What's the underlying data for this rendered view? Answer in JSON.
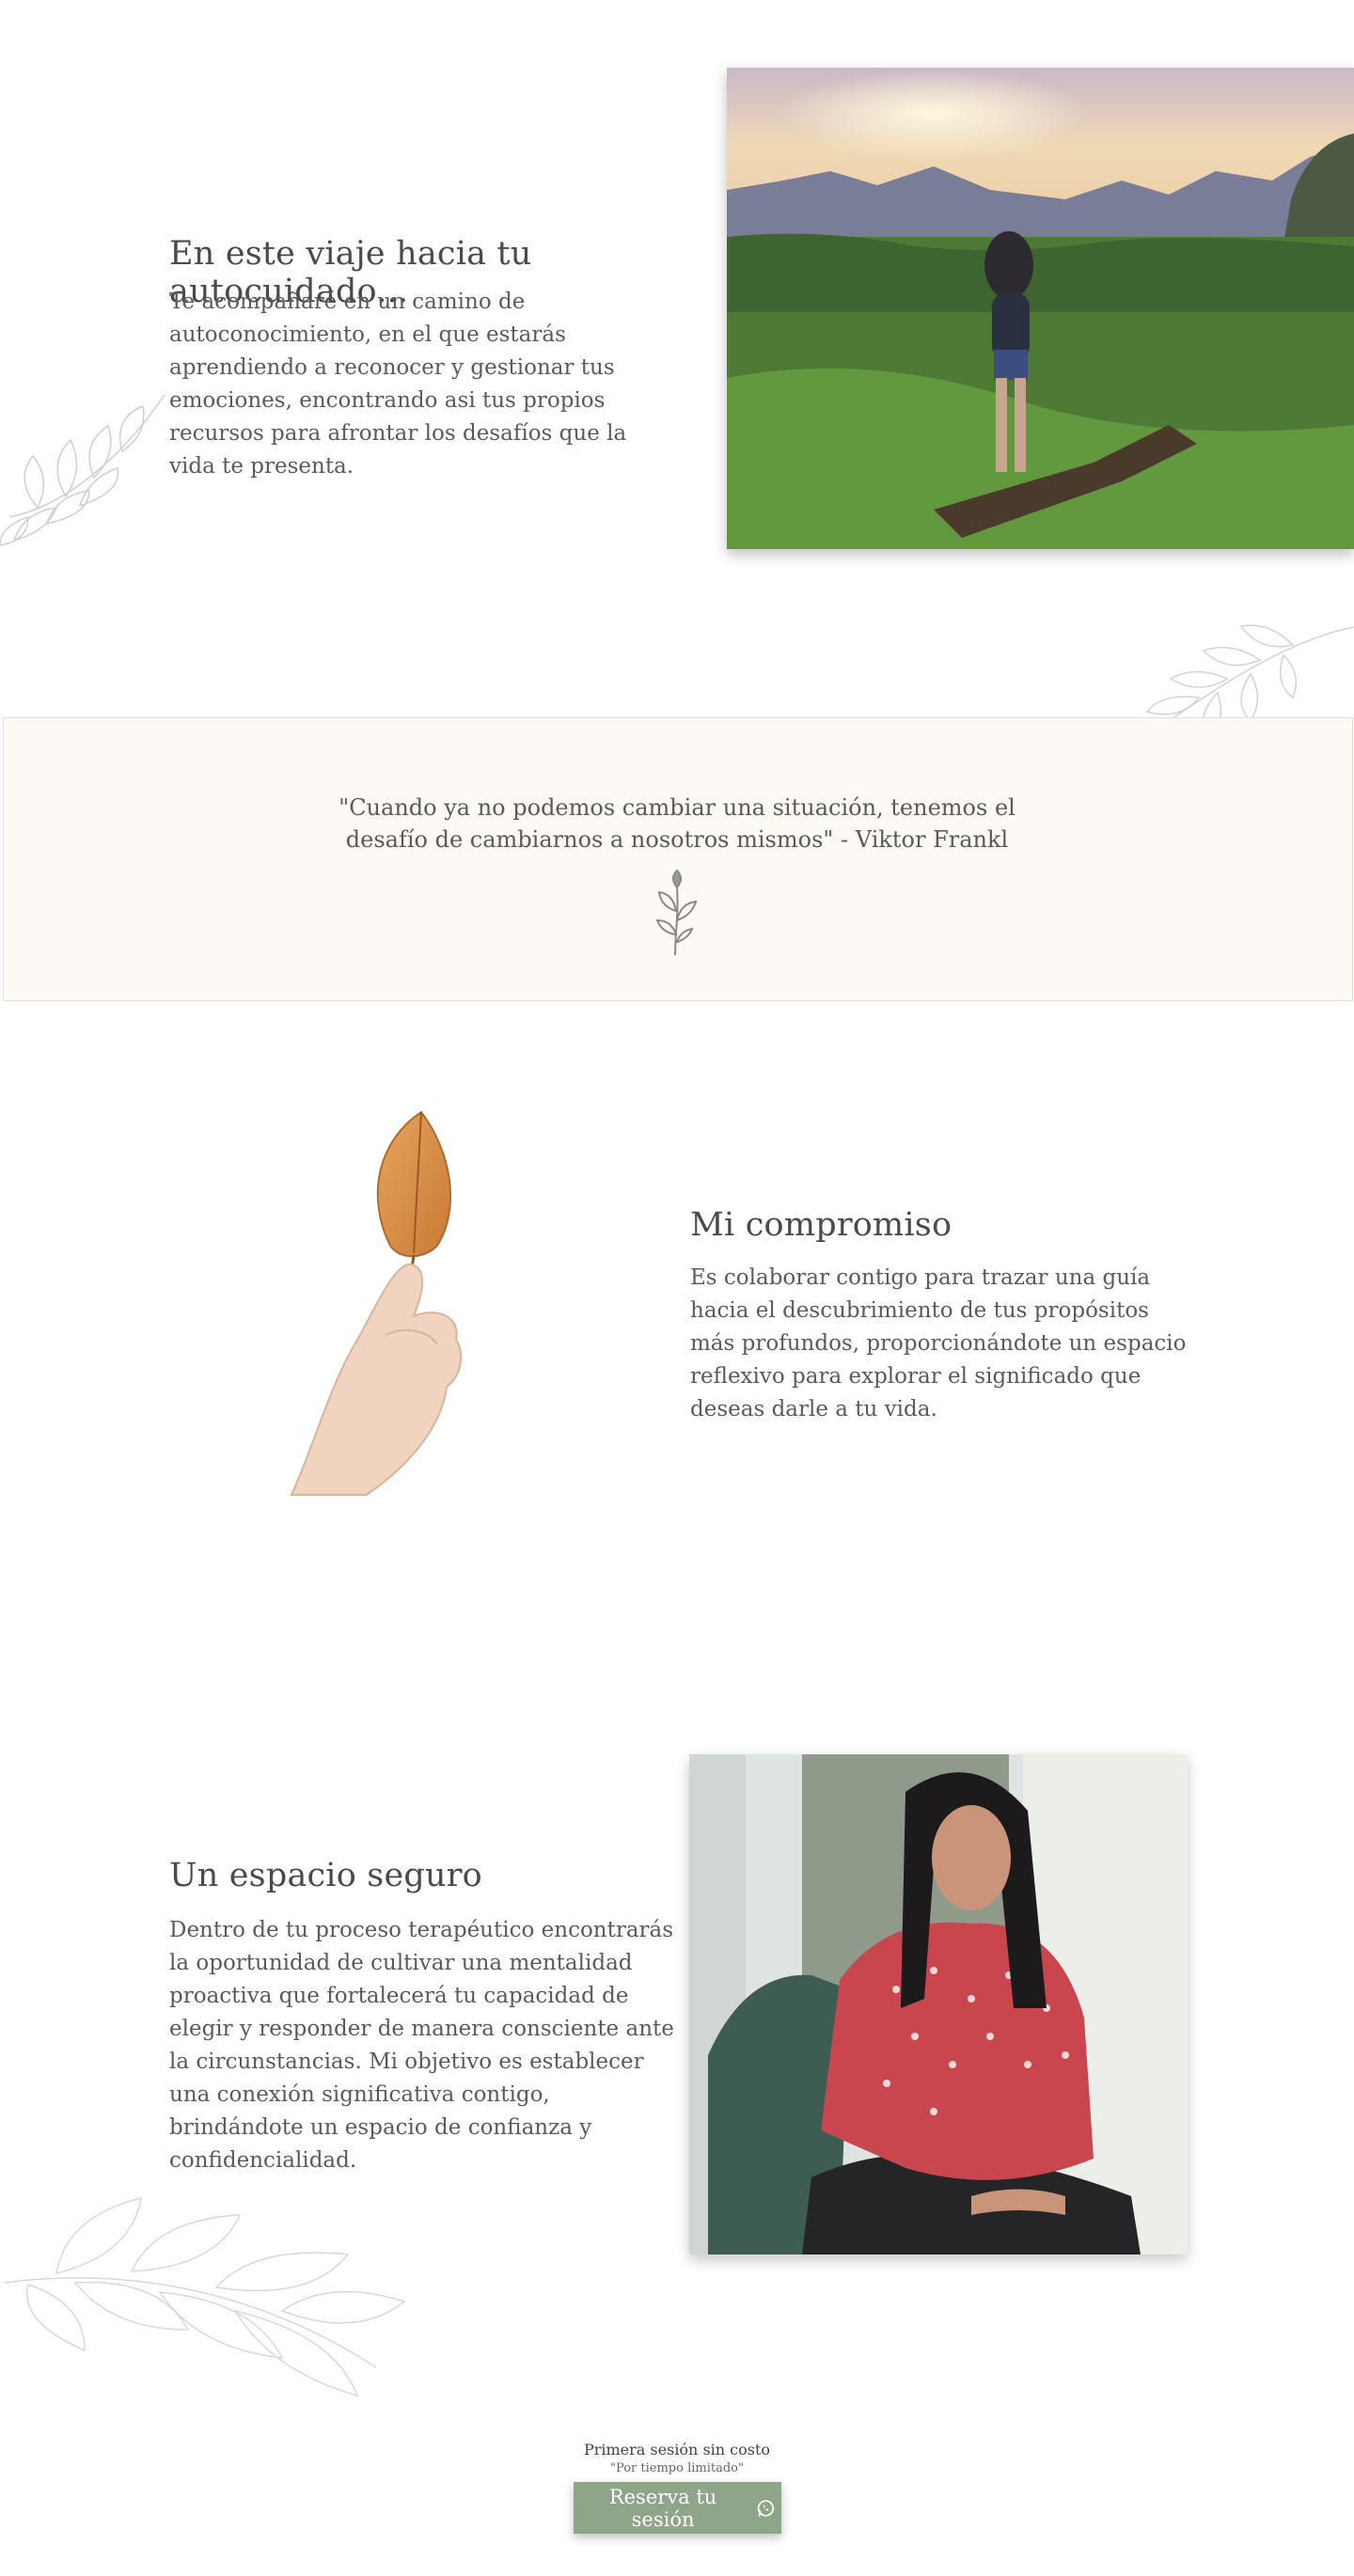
{
  "section_autocuidado": {
    "title": "En este viaje hacia tu autocuidado...",
    "text": "Te acompañaré en un camino de autoconocimiento, en el que estarás aprendiendo a reconocer y gestionar tus emociones, encontrando asi tus propios recursos para afrontar los desafíos que la vida te presenta.",
    "image_icon": "woman-at-sunset-landscape-photo"
  },
  "quote": {
    "text": "\"Cuando ya no podemos cambiar una situación, tenemos el desafío de cambiarnos a nosotros mismos\" - Viktor Frankl",
    "icon": "flower-sprig-icon"
  },
  "section_compromiso": {
    "title": "Mi compromiso",
    "text": "Es colaborar contigo para trazar una guía hacia el descubrimiento de tus propósitos más profundos, proporcionándote un espacio reflexivo para explorar el significado que deseas darle a tu vida.",
    "image_icon": "hand-holding-leaf-image"
  },
  "section_espacio": {
    "title": "Un espacio seguro",
    "text": "Dentro de tu proceso terapéutico encontrarás la oportunidad de cultivar una mentalidad proactiva que fortalecerá tu capacidad de elegir y responder de manera consciente ante la circunstancias. Mi objetivo es establecer una conexión significativa contigo, brindándote un espacio de confianza y confidencialidad.",
    "image_icon": "therapist-portrait-photo"
  },
  "cta": {
    "line1": "Primera sesión sin costo",
    "line2": "\"Por tiempo limitado\"",
    "button_label": "Reserva tu sesión",
    "button_icon": "whatsapp-icon"
  },
  "colors": {
    "accent": "#8fa58a",
    "quote_band": "#fdf9f5",
    "text": "#5a5a5a"
  }
}
